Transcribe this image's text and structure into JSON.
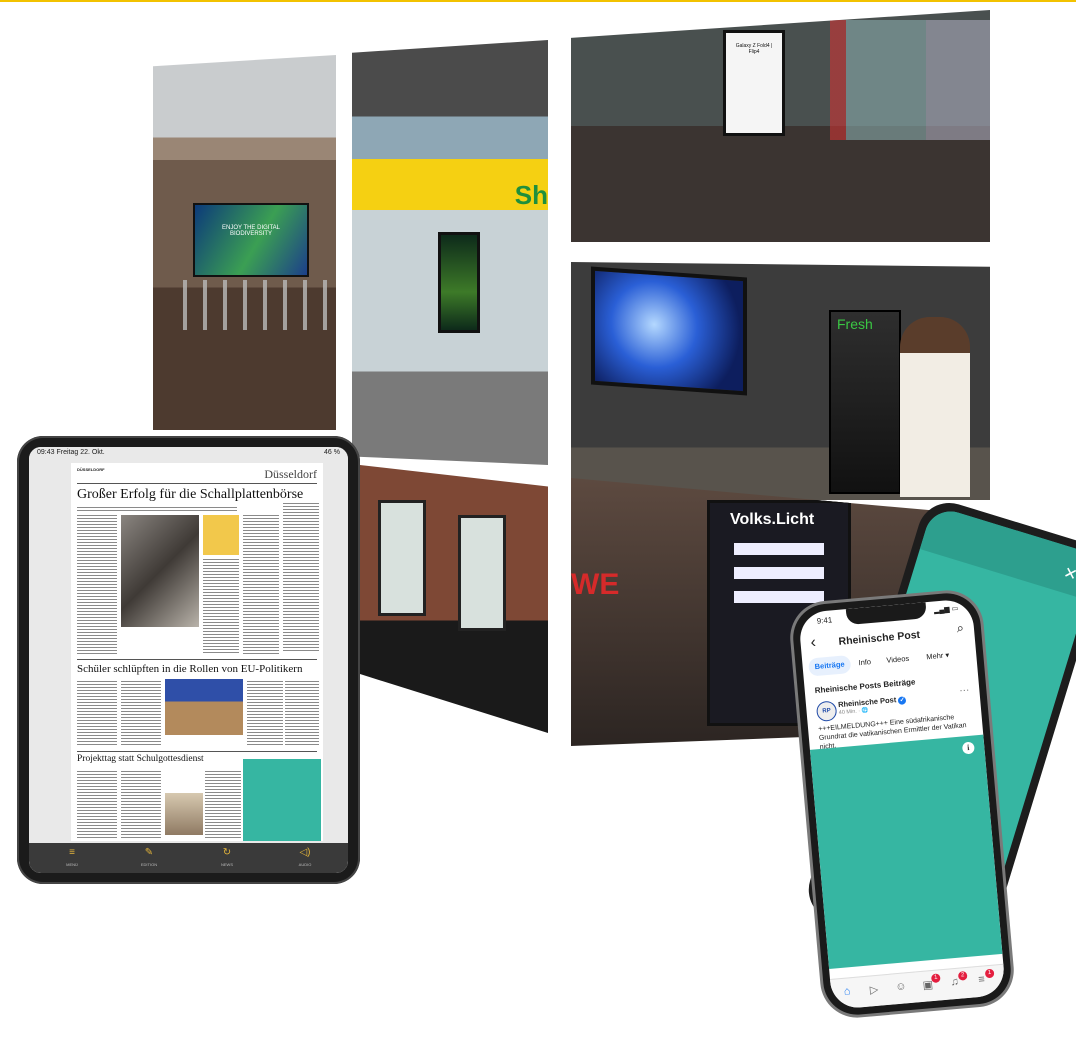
{
  "colors": {
    "accent_rule": "#f2c200",
    "teal": "#36b6a2",
    "facebook_blue": "#1877f2",
    "ipad_toolbar_icon": "#e3b43a"
  },
  "photos": {
    "lobby": {
      "screen_text": "ENJOY THE DIGITAL BIODIVERSITY"
    },
    "station": {
      "sign": "Sh"
    },
    "cafe": {
      "stand_text": "Galaxy Z Fold4 | Flip4"
    },
    "kiosk": {
      "fridge_brand": "Fresh"
    },
    "shop": {
      "board_title": "Volks.Licht",
      "store_letters": "WE"
    }
  },
  "ipad": {
    "status_time": "09:43  Freitag 22. Okt.",
    "status_battery": "46 %",
    "paper": {
      "masthead": "DÜSSELDORF",
      "city": "Düsseldorf",
      "headline_1": "Großer Erfolg für die Schallplattenbörse",
      "headline_2": "Schüler schlüpften in die Rollen von EU-Politikern",
      "headline_3": "Projekttag statt Schulgottesdienst"
    },
    "toolbar": [
      {
        "icon": "menu-icon",
        "glyph": "≡",
        "label": "MENÜ"
      },
      {
        "icon": "edit-icon",
        "glyph": "✎",
        "label": "EDITION"
      },
      {
        "icon": "refresh-icon",
        "glyph": "↻",
        "label": "NEWS"
      },
      {
        "icon": "audio-icon",
        "glyph": "◁)",
        "label": "AUDIO"
      }
    ]
  },
  "phone": {
    "time": "9:41",
    "page_title": "Rheinische Post",
    "tabs": [
      "Beiträge",
      "Info",
      "Videos",
      "Mehr ▾"
    ],
    "section_title": "Rheinische Posts Beiträge",
    "post": {
      "avatar": "RP",
      "author": "Rheinische Post",
      "meta": "40 Min. · 🌐",
      "text": "+++EILMELDUNG+++ Eine südafrikanische Grundrat die vatikanischen Ermittler der Vatikan nicht."
    },
    "nav": [
      {
        "icon": "home-icon",
        "glyph": "⌂",
        "badge": ""
      },
      {
        "icon": "video-icon",
        "glyph": "▷",
        "badge": ""
      },
      {
        "icon": "groups-icon",
        "glyph": "☺",
        "badge": ""
      },
      {
        "icon": "marketplace-icon",
        "glyph": "▣",
        "badge": "1"
      },
      {
        "icon": "notifications-icon",
        "glyph": "🔔",
        "badge": "2"
      },
      {
        "icon": "menu-icon",
        "glyph": "≡",
        "badge": "1"
      }
    ]
  }
}
